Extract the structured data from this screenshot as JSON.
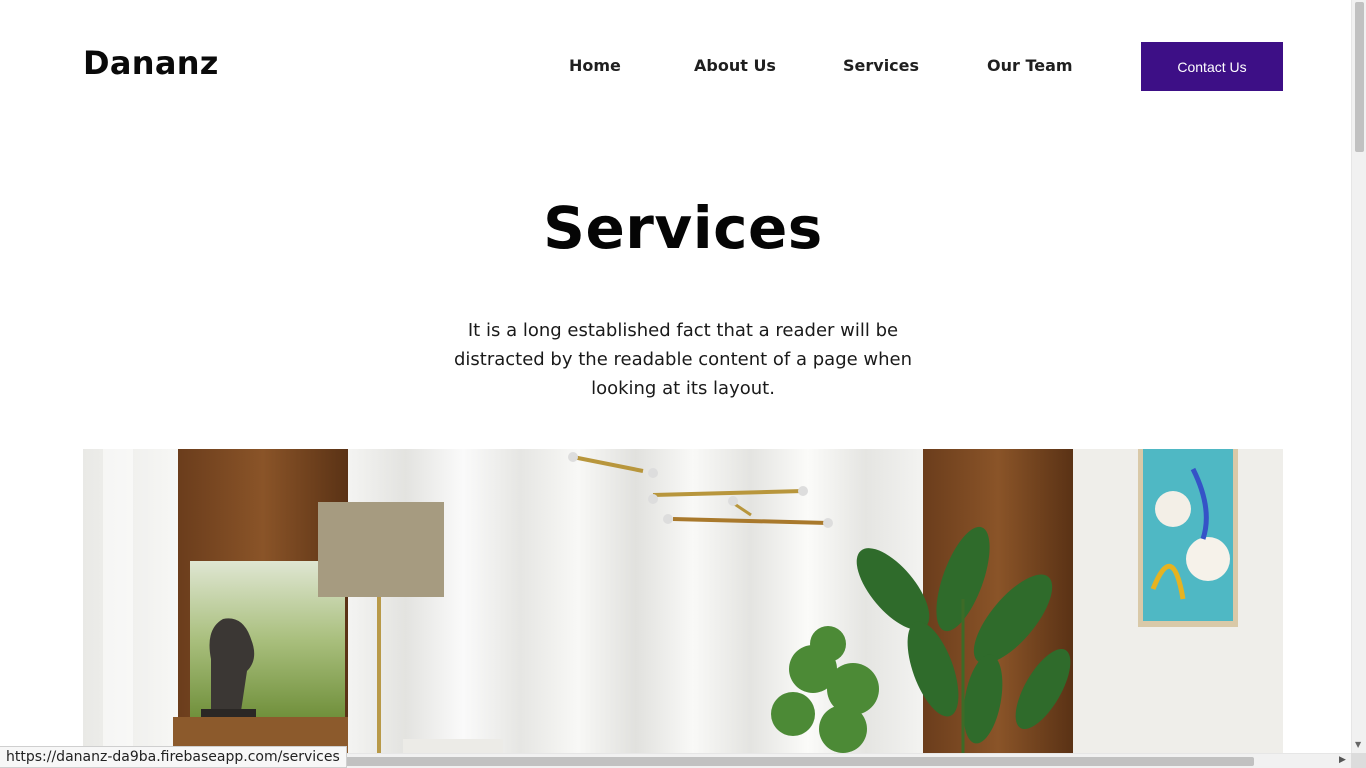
{
  "brand": {
    "logo": "Dananz"
  },
  "nav": {
    "items": [
      "Home",
      "About Us",
      "Services",
      "Our Team"
    ],
    "contact_label": "Contact Us"
  },
  "hero": {
    "title": "Services",
    "text": "It is a long established fact that a reader will be distracted by the readable content of a page when looking at its layout."
  },
  "status_bar": {
    "url": "https://dananz-da9ba.firebaseapp.com/services"
  },
  "colors": {
    "accent": "#3d0f86",
    "text": "#111111",
    "background": "#ffffff"
  },
  "icons": [
    "scroll-down-arrow-icon",
    "scroll-right-arrow-icon"
  ]
}
